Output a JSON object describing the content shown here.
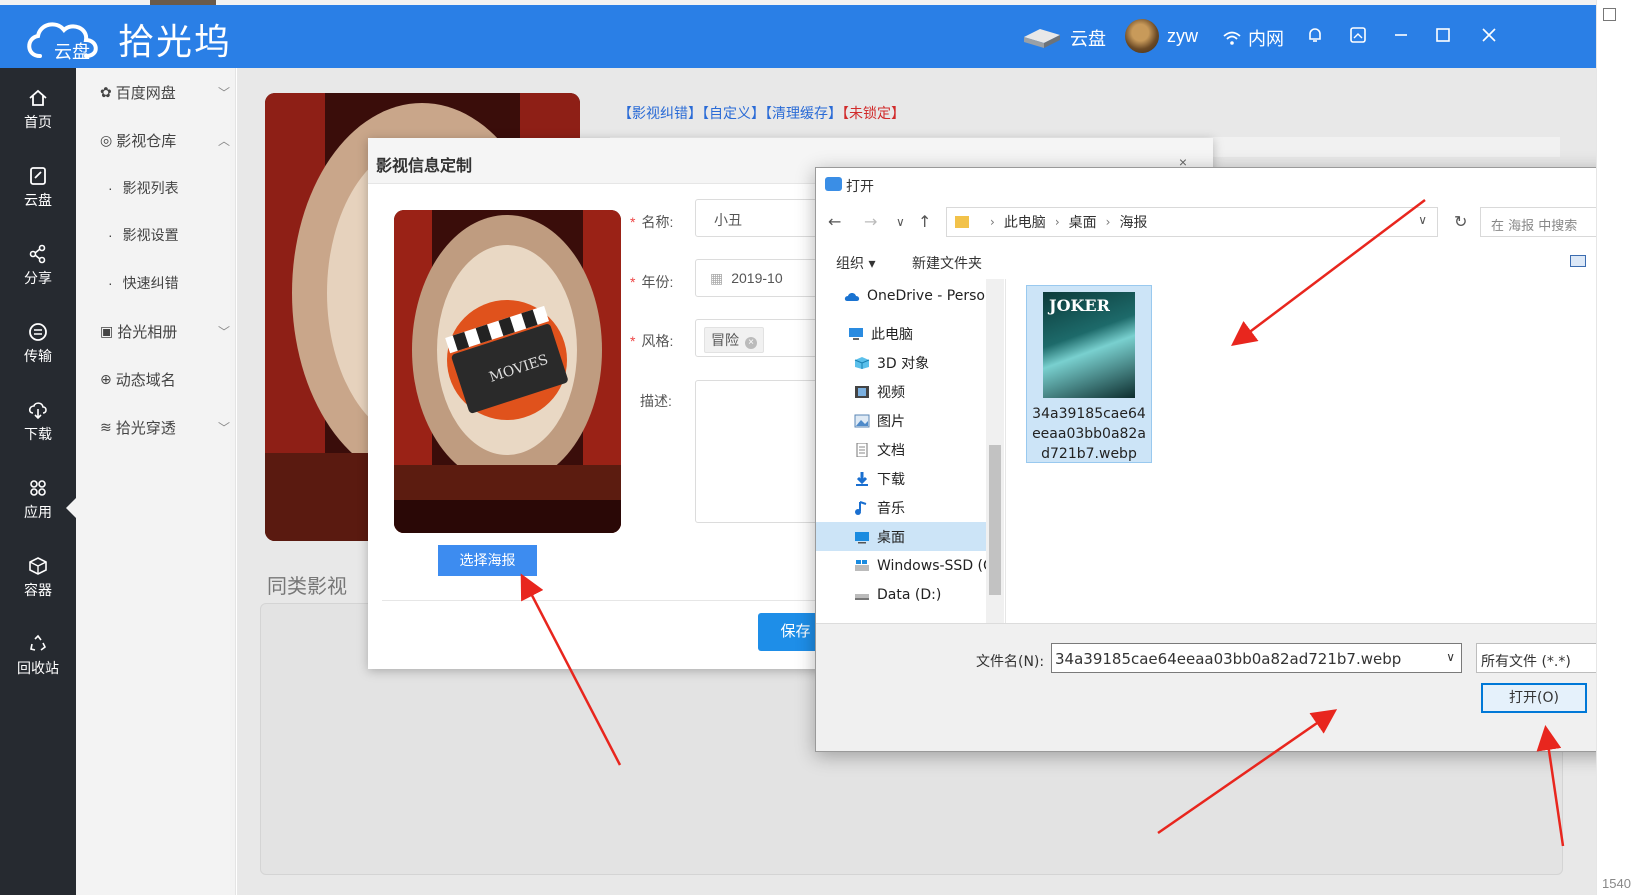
{
  "header": {
    "brand_short": "云盘",
    "app_title": "拾光坞",
    "cloud_label": "云盘",
    "user_name": "zyw",
    "network_label": "内网"
  },
  "nav": [
    {
      "label": "首页",
      "icon": "home-icon"
    },
    {
      "label": "云盘",
      "icon": "cloud-disk-icon"
    },
    {
      "label": "分享",
      "icon": "share-icon"
    },
    {
      "label": "传输",
      "icon": "transfer-icon"
    },
    {
      "label": "下载",
      "icon": "download-icon"
    },
    {
      "label": "应用",
      "icon": "apps-icon"
    },
    {
      "label": "容器",
      "icon": "container-icon"
    },
    {
      "label": "回收站",
      "icon": "recycle-icon"
    }
  ],
  "submenu": {
    "baidu": "百度网盘",
    "warehouse": "影视仓库",
    "movie_list": "影视列表",
    "movie_settings": "影视设置",
    "quick_fix": "快速纠错",
    "album": "拾光相册",
    "ddns": "动态域名",
    "tunnel": "拾光穿透"
  },
  "main": {
    "link_fix": "【影视纠错】",
    "link_custom": "【自定义】",
    "link_clear": "【清理缓存】",
    "link_unlocked": "【未锁定】",
    "similar_title": "同类影视"
  },
  "modal": {
    "title": "影视信息定制",
    "close": "×",
    "pick_poster": "选择海报",
    "name_label": "名称:",
    "name_value": "小丑",
    "year_label": "年份:",
    "year_value": "2019-10",
    "genre_label": "风格:",
    "genre_tag": "冒险",
    "desc_label": "描述:",
    "save": "保存",
    "required_mark": "*"
  },
  "file_dialog": {
    "title": "打开",
    "path": [
      "此电脑",
      "桌面",
      "海报"
    ],
    "search_placeholder": "在 海报 中搜索",
    "organize": "组织 ▾",
    "new_folder": "新建文件夹",
    "tree": [
      {
        "label": "OneDrive - Personal",
        "icon": "onedrive-icon"
      },
      {
        "label": "此电脑",
        "icon": "pc-icon"
      },
      {
        "label": "3D 对象",
        "icon": "3d-objects-icon"
      },
      {
        "label": "视频",
        "icon": "video-icon"
      },
      {
        "label": "图片",
        "icon": "pictures-icon"
      },
      {
        "label": "文档",
        "icon": "documents-icon"
      },
      {
        "label": "下载",
        "icon": "download-arrow-icon"
      },
      {
        "label": "音乐",
        "icon": "music-icon"
      },
      {
        "label": "桌面",
        "icon": "desktop-icon"
      },
      {
        "label": "Windows-SSD (C:)",
        "icon": "drive-c-icon"
      },
      {
        "label": "Data (D:)",
        "icon": "drive-d-icon"
      }
    ],
    "file_name": "34a39185cae64eeaa03bb0a82ad721b7.webp",
    "thumb_text": "JOKER",
    "filename_label": "文件名(N):",
    "filetype": "所有文件 (*.*)",
    "open_button": "打开(O)"
  },
  "outer": {
    "corner_number": "1540"
  },
  "colors": {
    "header_blue": "#2a7fe6",
    "nav_dark": "#262a30",
    "primary_button": "#1e8ee8",
    "arrow_red": "#e8261e"
  }
}
